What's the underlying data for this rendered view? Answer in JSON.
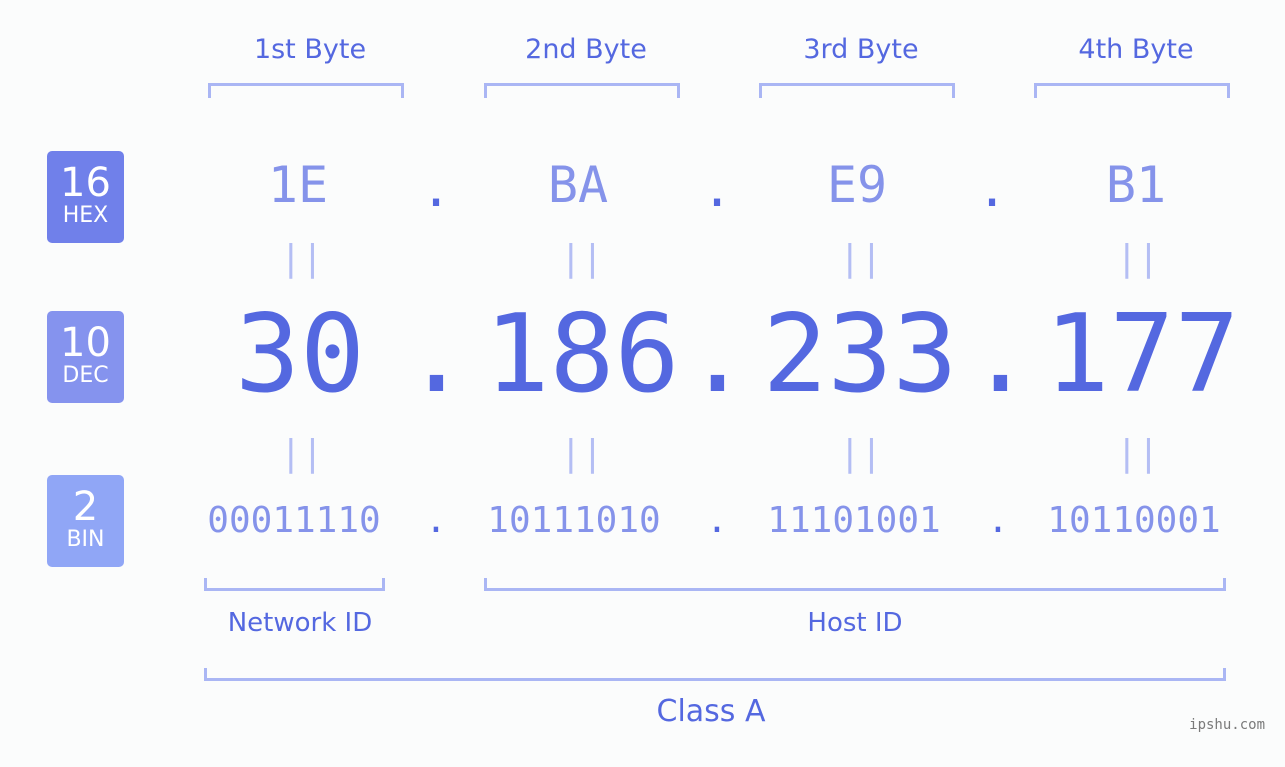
{
  "byte_labels": [
    "1st Byte",
    "2nd Byte",
    "3rd Byte",
    "4th Byte"
  ],
  "bases": {
    "hex": {
      "num": "16",
      "label": "HEX",
      "color": "#7080ea"
    },
    "dec": {
      "num": "10",
      "label": "DEC",
      "color": "#8593ee"
    },
    "bin": {
      "num": "2",
      "label": "BIN",
      "color": "#90a6f6"
    }
  },
  "hex": [
    "1E",
    "BA",
    "E9",
    "B1"
  ],
  "dec": [
    "30",
    "186",
    "233",
    "177"
  ],
  "bin": [
    "00011110",
    "10111010",
    "11101001",
    "10110001"
  ],
  "separator": ".",
  "equals": "||",
  "network_id_label": "Network ID",
  "host_id_label": "Host ID",
  "class_label": "Class A",
  "watermark": "ipshu.com"
}
